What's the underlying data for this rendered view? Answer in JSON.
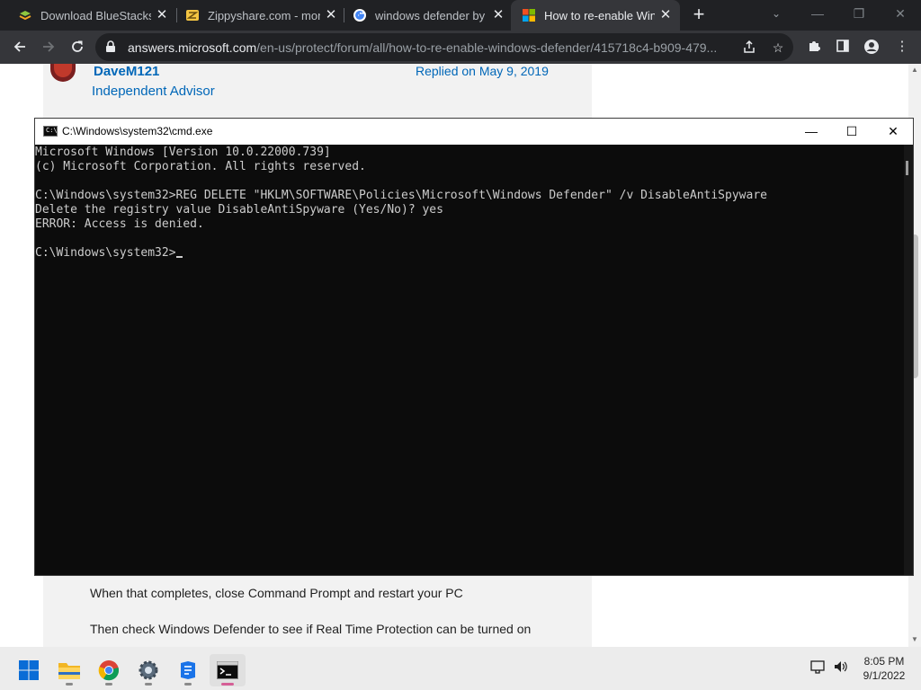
{
  "browser": {
    "tabs": [
      {
        "title": "Download BlueStacks - ",
        "favicon": "bluestacks-icon",
        "active": false
      },
      {
        "title": "Zippyshare.com - mon",
        "favicon": "zippyshare-icon",
        "active": false
      },
      {
        "title": "windows defender by n",
        "favicon": "google-icon",
        "active": false
      },
      {
        "title": "How to re-enable Wind",
        "favicon": "microsoft-icon",
        "active": true
      }
    ],
    "new_tab_label": "+",
    "url_host": "answers.microsoft.com",
    "url_path": "/en-us/protect/forum/all/how-to-re-enable-windows-defender/415718c4-b909-479..."
  },
  "page": {
    "author": "DaveM121",
    "role": "Independent Advisor",
    "replied": "Replied on May 9, 2019",
    "line1": "When that completes, close Command Prompt and restart your PC",
    "line2": "Then check Windows Defender to see if Real Time Protection can be turned on"
  },
  "cmd": {
    "title": "C:\\Windows\\system32\\cmd.exe",
    "lines": [
      "Microsoft Windows [Version 10.0.22000.739]",
      "(c) Microsoft Corporation. All rights reserved.",
      "",
      "C:\\Windows\\system32>REG DELETE \"HKLM\\SOFTWARE\\Policies\\Microsoft\\Windows Defender\" /v DisableAntiSpyware",
      "Delete the registry value DisableAntiSpyware (Yes/No)? yes",
      "ERROR: Access is denied.",
      "",
      "C:\\Windows\\system32>"
    ]
  },
  "taskbar": {
    "apps": [
      "start-icon",
      "file-explorer-icon",
      "chrome-icon",
      "settings-icon",
      "app-icon",
      "terminal-icon"
    ],
    "time": "8:05 PM",
    "date": "9/1/2022"
  },
  "colors": {
    "chrome_dark": "#202124",
    "chrome_toolbar": "#35363a",
    "link_blue": "#0067b8",
    "console_bg": "#0c0c0c",
    "console_text": "#cccccc"
  }
}
